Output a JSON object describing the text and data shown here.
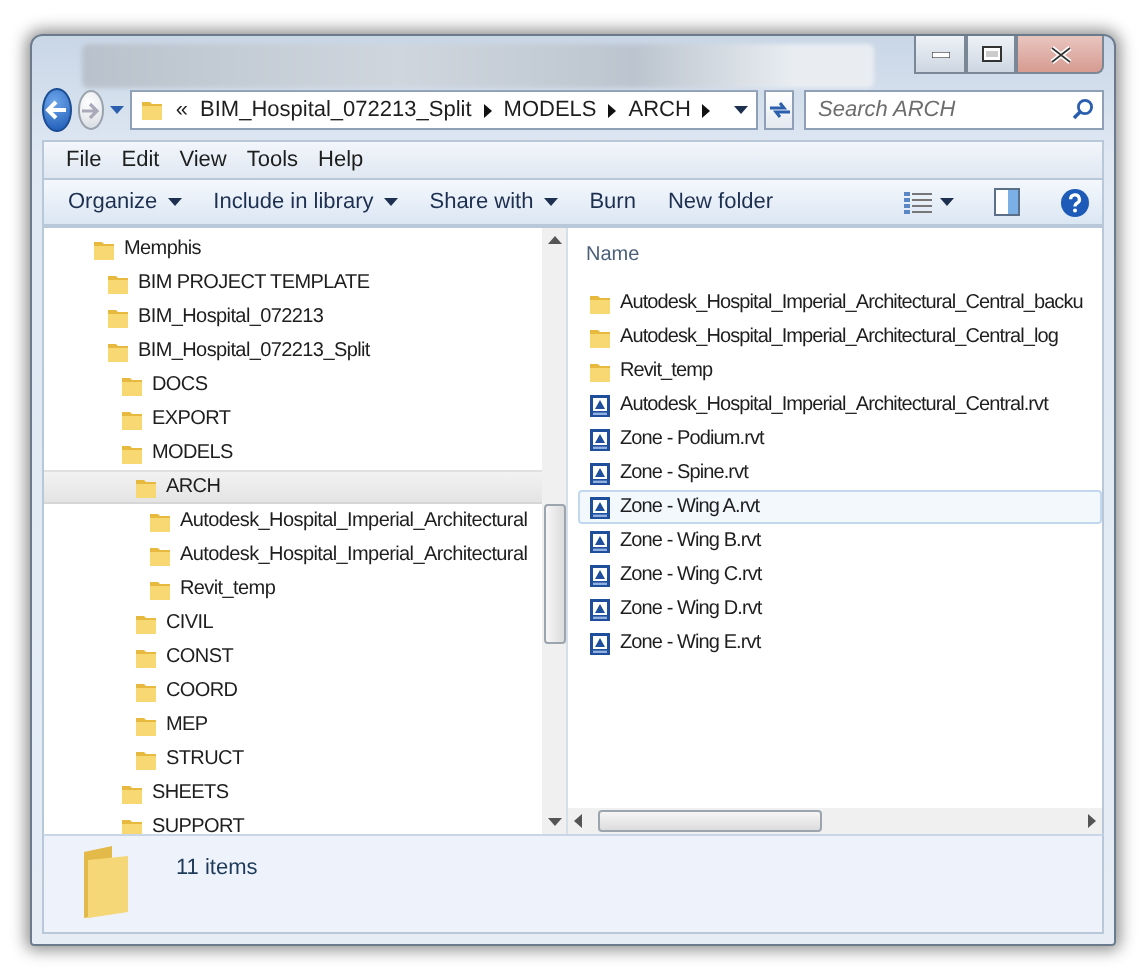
{
  "address": {
    "overflow": "«",
    "segments": [
      "BIM_Hospital_072213_Split",
      "MODELS",
      "ARCH"
    ]
  },
  "search": {
    "placeholder": "Search ARCH"
  },
  "menu": [
    "File",
    "Edit",
    "View",
    "Tools",
    "Help"
  ],
  "commands": [
    {
      "label": "Organize",
      "dropdown": true
    },
    {
      "label": "Include in library",
      "dropdown": true
    },
    {
      "label": "Share with",
      "dropdown": true
    },
    {
      "label": "Burn",
      "dropdown": false
    },
    {
      "label": "New folder",
      "dropdown": false
    }
  ],
  "nav_tree": [
    {
      "label": "Memphis",
      "selected": false,
      "children": [
        {
          "label": "BIM PROJECT TEMPLATE",
          "selected": false
        },
        {
          "label": "BIM_Hospital_072213",
          "selected": false
        },
        {
          "label": "BIM_Hospital_072213_Split",
          "selected": false,
          "children": [
            {
              "label": "DOCS",
              "selected": false
            },
            {
              "label": "EXPORT",
              "selected": false
            },
            {
              "label": "MODELS",
              "selected": false,
              "children": [
                {
                  "label": "ARCH",
                  "selected": true,
                  "children": [
                    {
                      "label": "Autodesk_Hospital_Imperial_Architectural",
                      "selected": false
                    },
                    {
                      "label": "Autodesk_Hospital_Imperial_Architectural",
                      "selected": false
                    },
                    {
                      "label": "Revit_temp",
                      "selected": false
                    }
                  ]
                },
                {
                  "label": "CIVIL",
                  "selected": false
                },
                {
                  "label": "CONST",
                  "selected": false
                },
                {
                  "label": "COORD",
                  "selected": false
                },
                {
                  "label": "MEP",
                  "selected": false
                },
                {
                  "label": "STRUCT",
                  "selected": false
                }
              ]
            },
            {
              "label": "SHEETS",
              "selected": false
            },
            {
              "label": "SUPPORT",
              "selected": false
            }
          ]
        }
      ]
    }
  ],
  "file_list": {
    "column": "Name",
    "items": [
      {
        "name": "Autodesk_Hospital_Imperial_Architectural_Central_backu",
        "kind": "folder",
        "selected": false
      },
      {
        "name": "Autodesk_Hospital_Imperial_Architectural_Central_log",
        "kind": "folder",
        "selected": false
      },
      {
        "name": "Revit_temp",
        "kind": "folder",
        "selected": false
      },
      {
        "name": "Autodesk_Hospital_Imperial_Architectural_Central.rvt",
        "kind": "rvt",
        "selected": false
      },
      {
        "name": "Zone - Podium.rvt",
        "kind": "rvt",
        "selected": false
      },
      {
        "name": "Zone - Spine.rvt",
        "kind": "rvt",
        "selected": false
      },
      {
        "name": "Zone - Wing A.rvt",
        "kind": "rvt",
        "selected": true
      },
      {
        "name": "Zone - Wing B.rvt",
        "kind": "rvt",
        "selected": false
      },
      {
        "name": "Zone - Wing C.rvt",
        "kind": "rvt",
        "selected": false
      },
      {
        "name": "Zone - Wing D.rvt",
        "kind": "rvt",
        "selected": false
      },
      {
        "name": "Zone - Wing E.rvt",
        "kind": "rvt",
        "selected": false
      }
    ]
  },
  "status": "11 items"
}
